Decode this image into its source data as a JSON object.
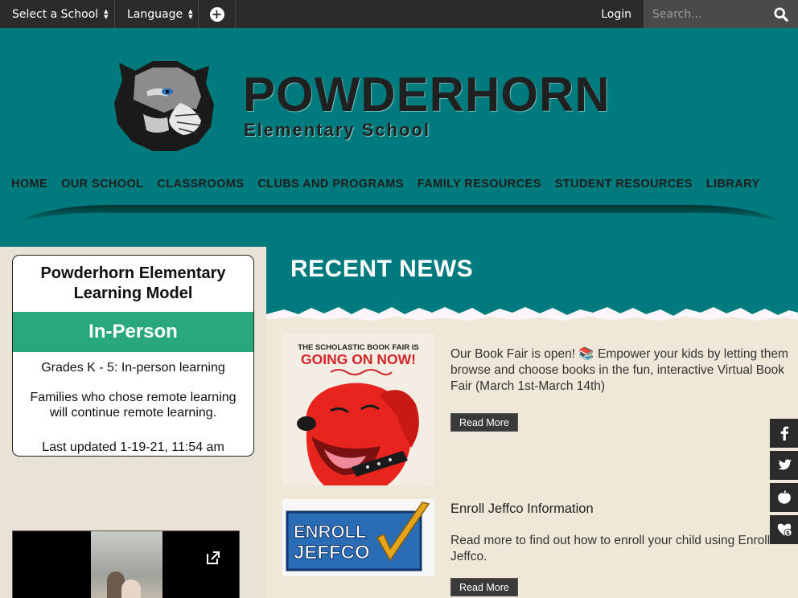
{
  "topbar": {
    "select_school": "Select a School",
    "language": "Language",
    "login": "Login",
    "search_placeholder": "Search..."
  },
  "header": {
    "title": "POWDERHORN",
    "subtitle": "Elementary School",
    "nav": [
      "HOME",
      "OUR SCHOOL",
      "CLASSROOMS",
      "CLUBS AND PROGRAMS",
      "FAMILY RESOURCES",
      "STUDENT RESOURCES",
      "LIBRARY"
    ]
  },
  "learning_model": {
    "title": "Powderhorn Elementary Learning Model",
    "status": "In-Person",
    "status_color": "#2aa87d",
    "line1": "Grades K - 5: In-person learning",
    "line2": "Families who chose remote learning will continue remote learning.",
    "updated": "Last updated 1-19-21, 11:54 am"
  },
  "news": {
    "heading": "RECENT NEWS",
    "articles": [
      {
        "image_text_top": "THE SCHOLASTIC BOOK FAIR IS",
        "image_text_main": "GOING ON NOW!",
        "text": "Our Book Fair is open! 📚 Empower your kids by letting them browse and choose books in the fun, interactive Virtual Book Fair (March 1st-March 14th)",
        "button": "Read More"
      },
      {
        "image_text_1": "ENROLL",
        "image_text_2": "JEFFCO",
        "title": "Enroll Jeffco Information",
        "text": "Read more to find out how to enroll your child using Enroll Jeffco.",
        "button": "Read More"
      }
    ]
  },
  "social": [
    "facebook-icon",
    "twitter-icon",
    "peachjar-icon",
    "donate-icon"
  ],
  "colors": {
    "teal": "#007b7d",
    "dark_bar": "#2b2b2b",
    "beige": "#e8e3d5"
  }
}
